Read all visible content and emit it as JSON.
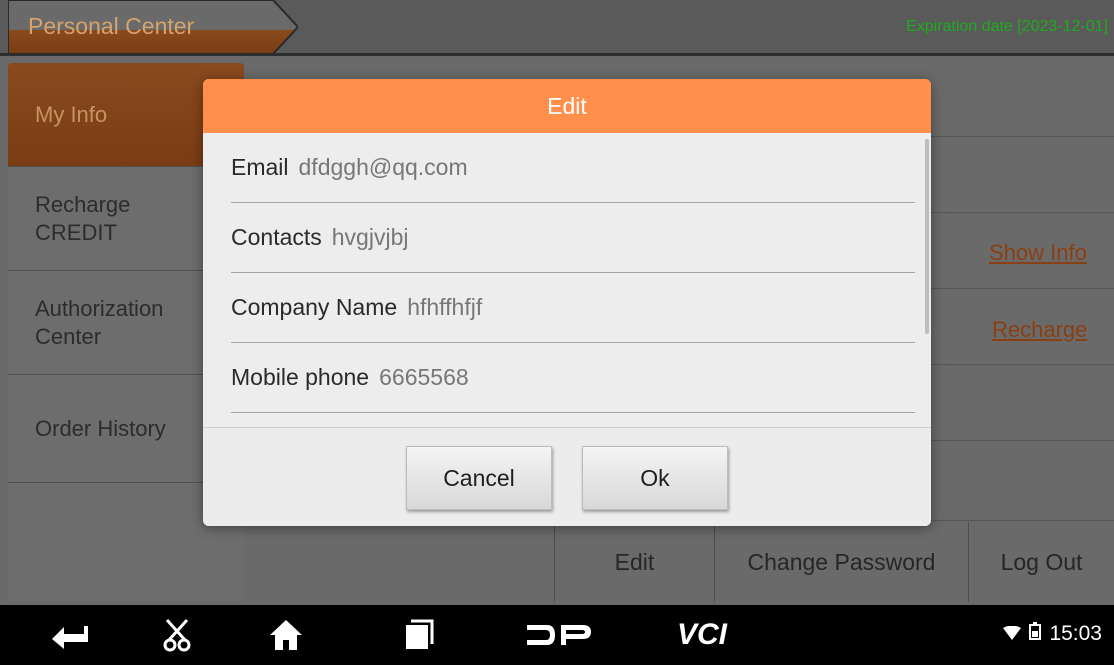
{
  "header": {
    "tab_title": "Personal Center",
    "expiration": "Expiration date [2023-12-01]"
  },
  "sidebar": {
    "items": [
      {
        "label": "My Info",
        "active": true
      },
      {
        "label": "Recharge\nCREDIT",
        "active": false
      },
      {
        "label": "Authorization\nCenter",
        "active": false
      },
      {
        "label": "Order History",
        "active": false
      }
    ]
  },
  "content": {
    "show_info_link": "Show Info",
    "recharge_link": "Recharge",
    "buttons": {
      "edit": "Edit",
      "change_password": "Change Password",
      "log_out": "Log Out"
    }
  },
  "dialog": {
    "title": "Edit",
    "fields": [
      {
        "label": "Email",
        "value": "dfdggh@qq.com"
      },
      {
        "label": "Contacts",
        "value": "hvgjvjbj"
      },
      {
        "label": "Company Name",
        "value": "hfhffhfjf"
      },
      {
        "label": "Mobile phone",
        "value": "6665568"
      }
    ],
    "cancel": "Cancel",
    "ok": "Ok"
  },
  "navbar": {
    "icons": [
      "back-icon",
      "scissors-icon",
      "home-icon",
      "recent-apps-icon",
      "dp-logo-icon",
      "vci-icon"
    ],
    "vci_label": "VCI",
    "time": "15:03"
  },
  "colors": {
    "dialog_header": "#ff8f4a",
    "active_tab": "#8a4a1e",
    "expiration_text": "#1faa1f"
  }
}
